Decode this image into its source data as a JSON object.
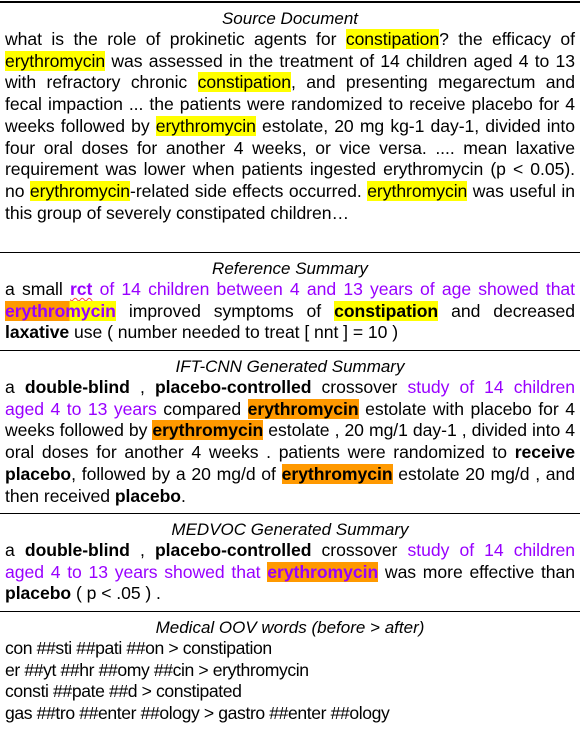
{
  "sections": {
    "source": {
      "title": "Source Document",
      "segments": [
        {
          "t": "what is the role of prokinetic agents for "
        },
        {
          "t": "constipation",
          "hl": "yellow"
        },
        {
          "t": "? the efficacy of "
        },
        {
          "t": "erythromycin",
          "hl": "yellow"
        },
        {
          "t": " was assessed in the treatment of 14 children aged 4 to 13 with refractory chronic "
        },
        {
          "t": "constipation",
          "hl": "yellow"
        },
        {
          "t": ", and presenting megarectum and fecal impaction ... the patients were randomized to receive placebo for 4 weeks followed by "
        },
        {
          "t": "erythromycin",
          "hl": "yellow"
        },
        {
          "t": " estolate, 20 mg kg-1 day-1, divided into four oral doses for another 4 weeks, or vice versa. .... mean laxative requirement was lower when patients ingested erythromycin (p < 0.05). no "
        },
        {
          "t": "erythromycin",
          "hl": "yellow"
        },
        {
          "t": "-related side effects occurred. "
        },
        {
          "t": "erythromycin",
          "hl": "yellow"
        },
        {
          "t": " was useful in this group of severely constipated children…"
        }
      ]
    },
    "reference": {
      "title": "Reference Summary",
      "segments": [
        {
          "t": "a small "
        },
        {
          "t": "rct",
          "bold": true,
          "purple": true,
          "squiggle": true
        },
        {
          "t": " of 14 children between 4 and 13 years of age showed that ",
          "purple": true
        },
        {
          "t": "erythromycin",
          "bold": true,
          "purple": true,
          "hl": "split"
        },
        {
          "t": " improved symptoms of "
        },
        {
          "t": "constipation",
          "bold": true,
          "hl": "yellow"
        },
        {
          "t": " and decreased "
        },
        {
          "t": "laxative",
          "bold": true
        },
        {
          "t": " use ( number needed to treat [ nnt ] = 10 )"
        }
      ]
    },
    "iftcnn": {
      "title": "IFT-CNN Generated Summary",
      "segments": [
        {
          "t": "a "
        },
        {
          "t": "double-blind",
          "bold": true
        },
        {
          "t": " , "
        },
        {
          "t": "placebo-controlled",
          "bold": true
        },
        {
          "t": " crossover "
        },
        {
          "t": "study of 14 children aged 4 to 13 years",
          "purple": true
        },
        {
          "t": " compared "
        },
        {
          "t": "erythromycin",
          "bold": true,
          "hl": "orange"
        },
        {
          "t": " estolate with placebo for 4 weeks followed by "
        },
        {
          "t": "erythromycin",
          "bold": true,
          "hl": "orange"
        },
        {
          "t": " estolate , 20 mg/1 day-1 , divided into 4 oral doses for another 4 weeks . patients were randomized to "
        },
        {
          "t": "receive placebo",
          "bold": true
        },
        {
          "t": ", followed by a 20 mg/d of "
        },
        {
          "t": "erythromycin",
          "bold": true,
          "hl": "orange"
        },
        {
          "t": " estolate 20 mg/d , and then received "
        },
        {
          "t": "placebo",
          "bold": true
        },
        {
          "t": "."
        }
      ]
    },
    "medvoc": {
      "title": "MEDVOC Generated Summary",
      "segments": [
        {
          "t": "a "
        },
        {
          "t": "double-blind",
          "bold": true
        },
        {
          "t": " , "
        },
        {
          "t": "placebo-controlled",
          "bold": true
        },
        {
          "t": " crossover "
        },
        {
          "t": "study of 14 children aged 4 to 13 years showed that ",
          "purple": true
        },
        {
          "t": "erythromycin",
          "bold": true,
          "purple": true,
          "hl": "orange"
        },
        {
          "t": " was more effective than "
        },
        {
          "t": "placebo",
          "bold": true
        },
        {
          "t": " ( p < .05 ) ."
        }
      ]
    },
    "oov": {
      "title": "Medical OOV words (before > after)",
      "lines": [
        "con ##sti ##pati ##on > constipation",
        "er ##yt ##hr ##omy ##cin > erythromycin",
        "consti ##pate ##d > constipated",
        "gas ##tro ##enter ##ology > gastro ##enter ##ology"
      ]
    }
  },
  "colors": {
    "yellow_highlight": "#ffff00",
    "orange_highlight": "#ff9900",
    "purple_text": "#9900ff"
  }
}
